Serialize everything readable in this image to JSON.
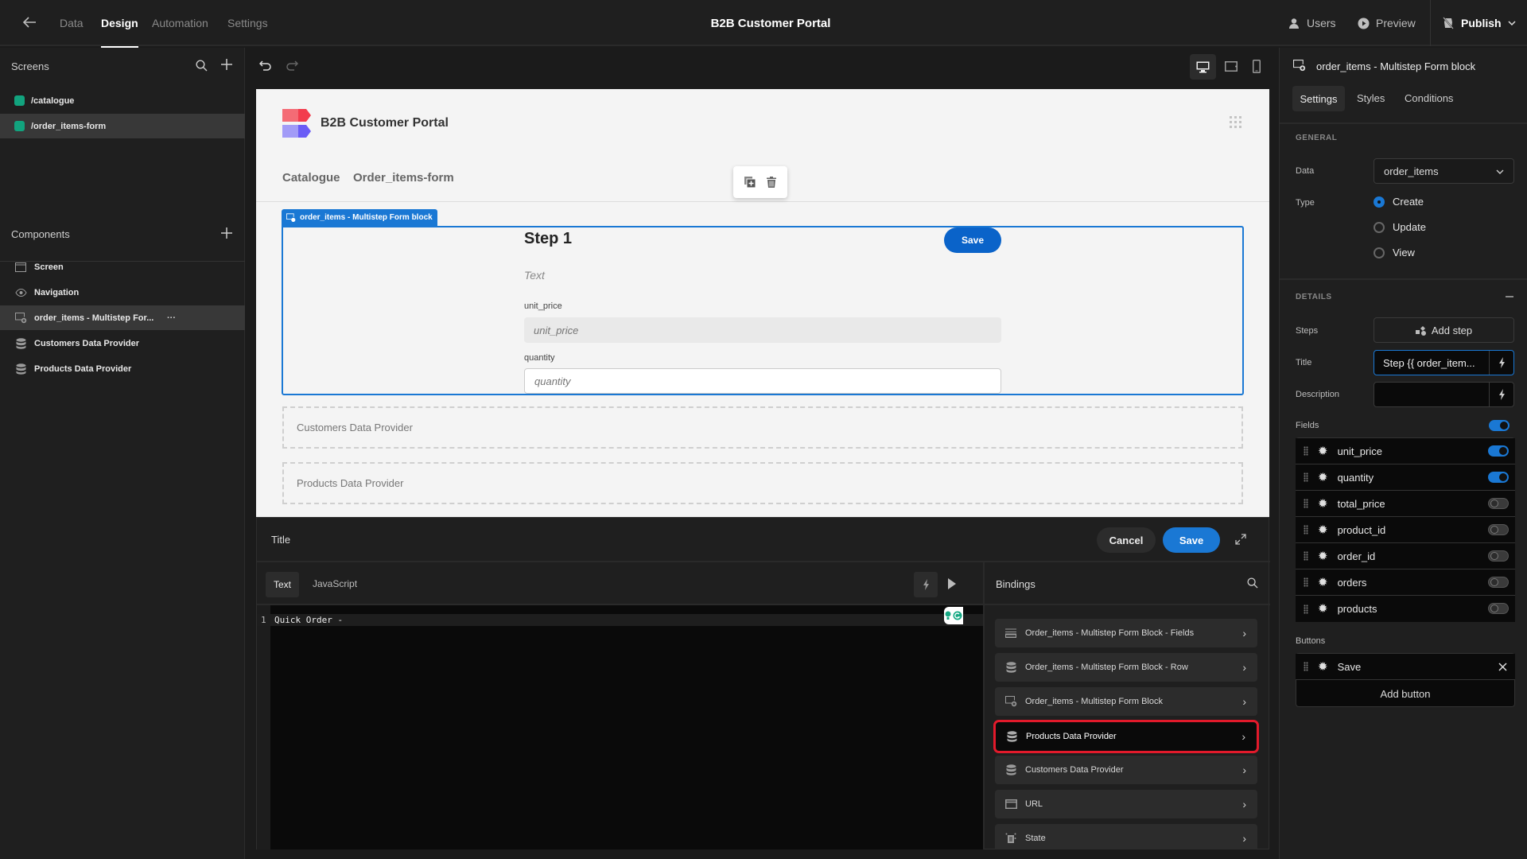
{
  "topbar": {
    "nav": [
      "Data",
      "Design",
      "Automation",
      "Settings"
    ],
    "active_nav": "Design",
    "app_title": "B2B Customer Portal",
    "users_label": "Users",
    "preview_label": "Preview",
    "publish_label": "Publish"
  },
  "screens": {
    "header": "Screens",
    "items": [
      {
        "label": "/catalogue",
        "color": "#12a37e",
        "selected": false
      },
      {
        "label": "/order_items-form",
        "color": "#12a37e",
        "selected": true
      }
    ]
  },
  "components": {
    "header": "Components",
    "items": [
      {
        "label": "Screen",
        "icon": "screen-icon",
        "selected": false
      },
      {
        "label": "Navigation",
        "icon": "eye-icon",
        "selected": false
      },
      {
        "label": "order_items - Multistep For...",
        "icon": "form-block-icon",
        "selected": true
      },
      {
        "label": "Customers Data Provider",
        "icon": "database-icon",
        "selected": false
      },
      {
        "label": "Products Data Provider",
        "icon": "database-icon",
        "selected": false
      }
    ],
    "more_label": "···"
  },
  "preview": {
    "brand": "B2B Customer Portal",
    "nav": [
      "Catalogue",
      "Order_items-form"
    ],
    "block_tag": "order_items - Multistep Form block",
    "step_title": "Step 1",
    "step_description": "Text",
    "save_label": "Save",
    "fields": [
      {
        "label": "unit_price",
        "placeholder": "unit_price",
        "disabled": true
      },
      {
        "label": "quantity",
        "placeholder": "quantity",
        "disabled": false
      }
    ],
    "providers": [
      "Customers Data Provider",
      "Products Data Provider"
    ]
  },
  "editor": {
    "title": "Title",
    "cancel_label": "Cancel",
    "save_label": "Save",
    "modes": [
      "Text",
      "JavaScript"
    ],
    "active_mode": "Text",
    "line_number": "1",
    "code": "Quick Order -",
    "bindings_header": "Bindings",
    "bindings": [
      {
        "label": "Order_items - Multistep Form Block - Fields",
        "icon": "fields-icon",
        "highlighted": false
      },
      {
        "label": "Order_items - Multistep Form Block - Row",
        "icon": "database-icon",
        "highlighted": false
      },
      {
        "label": "Order_items - Multistep Form Block",
        "icon": "form-block-icon",
        "highlighted": false
      },
      {
        "label": "Products Data Provider",
        "icon": "database-icon",
        "highlighted": true
      },
      {
        "label": "Customers Data Provider",
        "icon": "database-icon",
        "highlighted": false
      },
      {
        "label": "URL",
        "icon": "url-icon",
        "highlighted": false
      },
      {
        "label": "State",
        "icon": "state-icon",
        "highlighted": false
      }
    ]
  },
  "settings": {
    "component_title": "order_items - Multistep Form block",
    "tabs": [
      "Settings",
      "Styles",
      "Conditions"
    ],
    "active_tab": "Settings",
    "general_header": "GENERAL",
    "data_label": "Data",
    "data_value": "order_items",
    "type_label": "Type",
    "type_options": [
      "Create",
      "Update",
      "View"
    ],
    "type_selected": "Create",
    "details_header": "DETAILS",
    "steps_label": "Steps",
    "add_step_label": "Add step",
    "title_label": "Title",
    "title_value": "Step {{ order_item...",
    "description_label": "Description",
    "description_value": "",
    "fields_label": "Fields",
    "fields_enabled": true,
    "fields": [
      {
        "name": "unit_price",
        "enabled": true
      },
      {
        "name": "quantity",
        "enabled": true
      },
      {
        "name": "total_price",
        "enabled": false
      },
      {
        "name": "product_id",
        "enabled": false
      },
      {
        "name": "order_id",
        "enabled": false
      },
      {
        "name": "orders",
        "enabled": false
      },
      {
        "name": "products",
        "enabled": false
      }
    ],
    "buttons_label": "Buttons",
    "buttons": [
      {
        "name": "Save"
      }
    ],
    "add_button_label": "Add button"
  },
  "colors": {
    "accent": "#1a78d4",
    "highlight": "#e21a2b",
    "screen_swatch": "#12a37e"
  }
}
